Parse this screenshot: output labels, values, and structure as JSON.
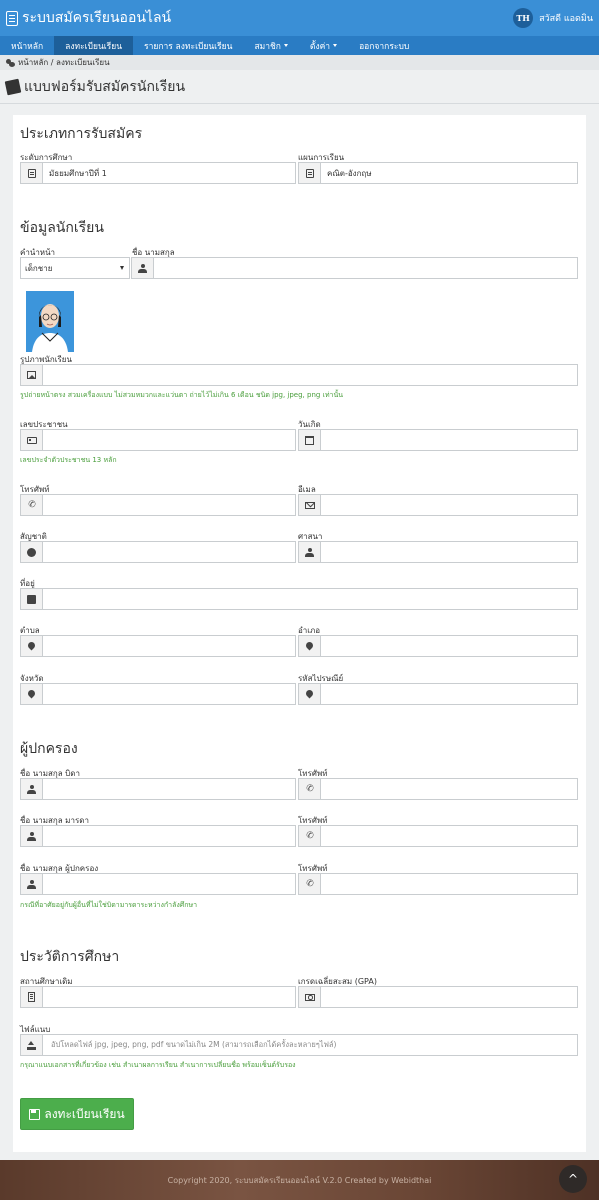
{
  "app": {
    "title": "ระบบสมัครเรียนออนไลน์"
  },
  "user": {
    "initials": "TH",
    "greeting": "สวัสดี แอดมิน"
  },
  "nav": {
    "home": "หน้าหลัก",
    "register": "ลงทะเบียนเรียน",
    "list": "รายการ ลงทะเบียนเรียน",
    "members": "สมาชิก",
    "settings": "ตั้งค่า",
    "logout": "ออกจากระบบ"
  },
  "breadcrumb": "หน้าหลัก / ลงทะเบียนเรียน",
  "page_title": "แบบฟอร์มรับสมัครนักเรียน",
  "sections": {
    "type": "ประเภทการรับสมัคร",
    "student": "ข้อมูลนักเรียน",
    "guardian": "ผู้ปกครอง",
    "education": "ประวัติการศึกษา"
  },
  "fields": {
    "level_label": "ระดับการศึกษา",
    "level_value": "มัธยมศึกษาปีที่ 1",
    "plan_label": "แผนการเรียน",
    "plan_value": "คณิต-อังกฤษ",
    "prefix_label": "คำนำหน้า",
    "prefix_value": "เด็กชาย",
    "name_label": "ชื่อ นามสกุล",
    "photo_label": "รูปภาพนักเรียน",
    "photo_help": "รูปถ่ายหน้าตรง สวมเครื่องแบบ ไม่สวมหมวกและแว่นตา ถ่ายไว้ไม่เกิน 6 เดือน ชนิด jpg, jpeg, png เท่านั้น",
    "idcard_label": "เลขประชาชน",
    "idcard_help": "เลขประจำตัวประชาชน 13 หลัก",
    "birth_label": "วันเกิด",
    "phone_label": "โทรศัพท์",
    "email_label": "อีเมล",
    "nationality_label": "สัญชาติ",
    "religion_label": "ศาสนา",
    "address_label": "ที่อยู่",
    "subdistrict_label": "ตำบล",
    "district_label": "อำเภอ",
    "province_label": "จังหวัด",
    "zipcode_label": "รหัสไปรษณีย์",
    "father_label": "ชื่อ นามสกุล บิดา",
    "father_phone_label": "โทรศัพท์",
    "mother_label": "ชื่อ นามสกุล มารดา",
    "mother_phone_label": "โทรศัพท์",
    "guardian_label": "ชื่อ นามสกุล ผู้ปกครอง",
    "guardian_phone_label": "โทรศัพท์",
    "guardian_help": "กรณีที่อาศัยอยู่กับผู้อื่นที่ไม่ใช่บิดามารดาระหว่างกำลังศึกษา",
    "school_label": "สถานศึกษาเดิม",
    "gpa_label": "เกรดเฉลี่ยสะสม (GPA)",
    "attach_label": "ไฟล์แนบ",
    "attach_placeholder": "อัปโหลดไฟล์ jpg, jpeg, png, pdf ขนาดไม่เกิน 2M (สามารถเลือกได้ครั้งละหลายๆไฟล์)",
    "attach_help": "กรุณาแนบเอกสารที่เกี่ยวข้อง เช่น สำเนาผลการเรียน สำเนาการเปลี่ยนชื่อ พร้อมเซ็นต์รับรอง"
  },
  "submit_label": "ลงทะเบียนเรียน",
  "footer": "Copyright 2020, ระบบสมัครเรียนออนไลน์ V.2.0 Created by Webidthai",
  "colors": {
    "topbar": "#3a8fd6",
    "navbar": "#2a7cc4",
    "submit": "#4cae4c",
    "help_text": "#4a9e3c"
  }
}
